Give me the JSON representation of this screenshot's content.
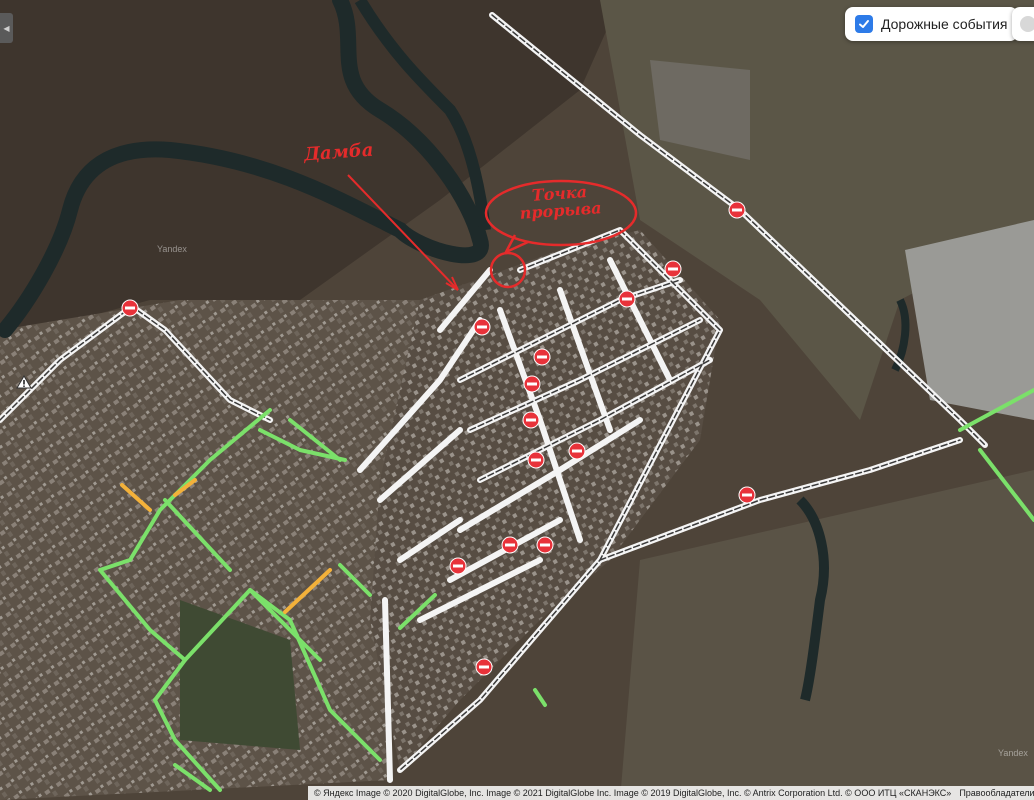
{
  "map": {
    "watermarks": [
      "Yandex",
      "Yandex"
    ],
    "annotations": {
      "dam_label": "Дамба",
      "breach_label": "Точка прорыва"
    },
    "colors": {
      "annotation": "#e52b2b",
      "closure_marker": "#e8323a",
      "road_closed": "#ececec",
      "traffic_free": "#7be06a",
      "traffic_slow": "#f3b13a",
      "water": "#1e2a2a",
      "satellite_ground": "#4e4439"
    },
    "icons": {
      "closure": "road-closed-icon",
      "warning": "warning-triangle-icon",
      "collapse": "chevron-left-icon",
      "check": "check-icon"
    }
  },
  "controls": {
    "traffic_events_label": "Дорожные события",
    "traffic_events_checked": true
  },
  "footer": {
    "copyright": "© Яндекс Image © 2020 DigitalGlobe, Inc. Image © 2021 DigitalGlobe Inc. Image © 2019 DigitalGlobe, Inc. © Antrix Corporation Ltd. © ООО ИТЦ «СКАНЭКС»",
    "rights_link": "Правообладатели"
  }
}
